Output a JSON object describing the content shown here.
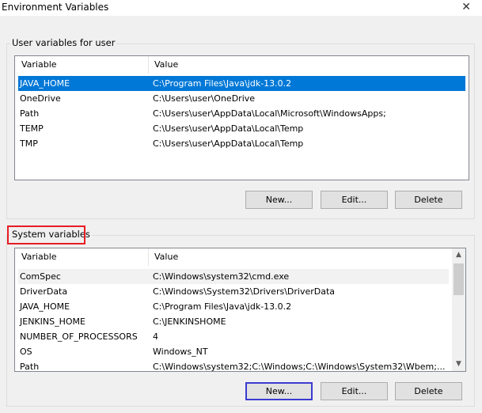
{
  "window": {
    "title": "Environment Variables",
    "close_glyph": "✕"
  },
  "user_section": {
    "legend": "User variables for user",
    "columns": [
      "Variable",
      "Value"
    ],
    "rows": [
      {
        "variable": "JAVA_HOME",
        "value": "C:\\Program Files\\Java\\jdk-13.0.2",
        "selected": true
      },
      {
        "variable": "OneDrive",
        "value": "C:\\Users\\user\\OneDrive"
      },
      {
        "variable": "Path",
        "value": "C:\\Users\\user\\AppData\\Local\\Microsoft\\WindowsApps;"
      },
      {
        "variable": "TEMP",
        "value": "C:\\Users\\user\\AppData\\Local\\Temp"
      },
      {
        "variable": "TMP",
        "value": "C:\\Users\\user\\AppData\\Local\\Temp"
      }
    ],
    "buttons": {
      "new": "New...",
      "edit": "Edit...",
      "delete": "Delete"
    }
  },
  "system_section": {
    "legend": "System variables",
    "columns": [
      "Variable",
      "Value"
    ],
    "rows": [
      {
        "variable": "ComSpec",
        "value": "C:\\Windows\\system32\\cmd.exe",
        "hover": true
      },
      {
        "variable": "DriverData",
        "value": "C:\\Windows\\System32\\Drivers\\DriverData"
      },
      {
        "variable": "JAVA_HOME",
        "value": "C:\\Program Files\\Java\\jdk-13.0.2"
      },
      {
        "variable": "JENKINS_HOME",
        "value": "C:\\JENKINSHOME"
      },
      {
        "variable": "NUMBER_OF_PROCESSORS",
        "value": "4"
      },
      {
        "variable": "OS",
        "value": "Windows_NT"
      },
      {
        "variable": "Path",
        "value": "C:\\Windows\\system32;C:\\Windows;C:\\Windows\\System32\\Wbem;..."
      }
    ],
    "buttons": {
      "new": "New...",
      "edit": "Edit...",
      "delete": "Delete"
    },
    "scroll_up_glyph": "▲",
    "scroll_down_glyph": "▼"
  },
  "colors": {
    "selection": "#0078d7",
    "highlight_box": "#e81c24",
    "focus_box": "#3b3bd1"
  }
}
